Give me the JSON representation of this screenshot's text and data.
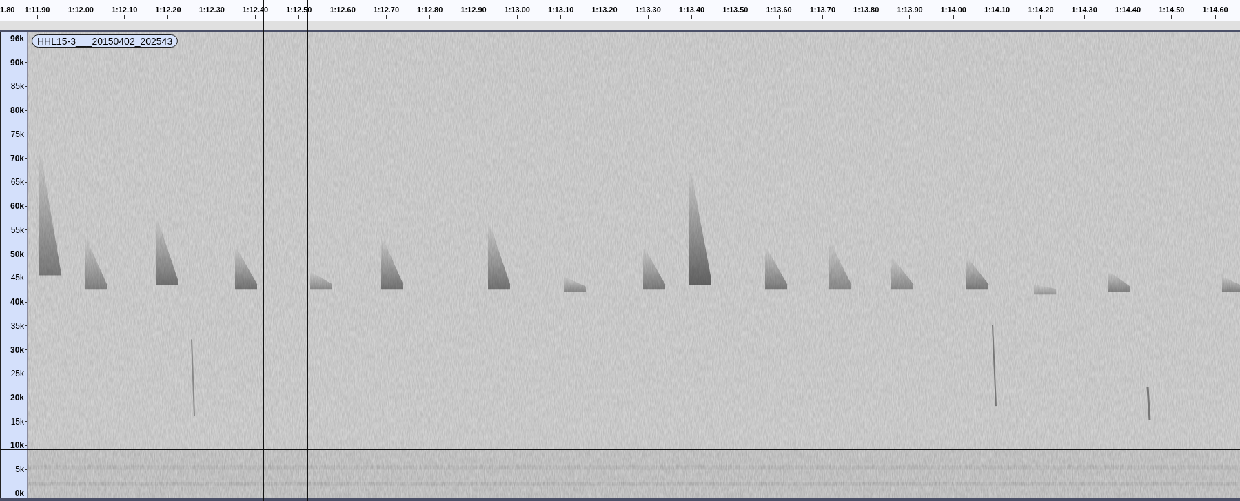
{
  "ruler": {
    "labels": [
      "1.80",
      "1:11.90",
      "1:12.00",
      "1:12.10",
      "1:12.20",
      "1:12.30",
      "1:12.40",
      "1:12.50",
      "1:12.60",
      "1:12.70",
      "1:12.80",
      "1:12.90",
      "1:13.00",
      "1:13.10",
      "1:13.20",
      "1:13.30",
      "1:13.40",
      "1:13.50",
      "1:13.60",
      "1:13.70",
      "1:13.80",
      "1:13.90",
      "1:14.00",
      "1:14.10",
      "1:14.20",
      "1:14.30",
      "1:14.40",
      "1:14.50",
      "1:14.60"
    ]
  },
  "track": {
    "name": "HHL15-3___20150402_202543",
    "frequency_axis": [
      {
        "label": "96k",
        "major": true
      },
      {
        "label": "90k",
        "major": true
      },
      {
        "label": "85k",
        "major": false
      },
      {
        "label": "80k",
        "major": true
      },
      {
        "label": "75k",
        "major": false
      },
      {
        "label": "70k",
        "major": true
      },
      {
        "label": "65k",
        "major": false
      },
      {
        "label": "60k",
        "major": true
      },
      {
        "label": "55k",
        "major": false
      },
      {
        "label": "50k",
        "major": true
      },
      {
        "label": "45k",
        "major": false
      },
      {
        "label": "40k",
        "major": true
      },
      {
        "label": "35k",
        "major": false
      },
      {
        "label": "30k",
        "major": true
      },
      {
        "label": "25k",
        "major": false
      },
      {
        "label": "20k",
        "major": true
      },
      {
        "label": "15k",
        "major": false
      },
      {
        "label": "10k",
        "major": true
      },
      {
        "label": "5k",
        "major": false
      },
      {
        "label": "0k",
        "major": true
      }
    ]
  }
}
